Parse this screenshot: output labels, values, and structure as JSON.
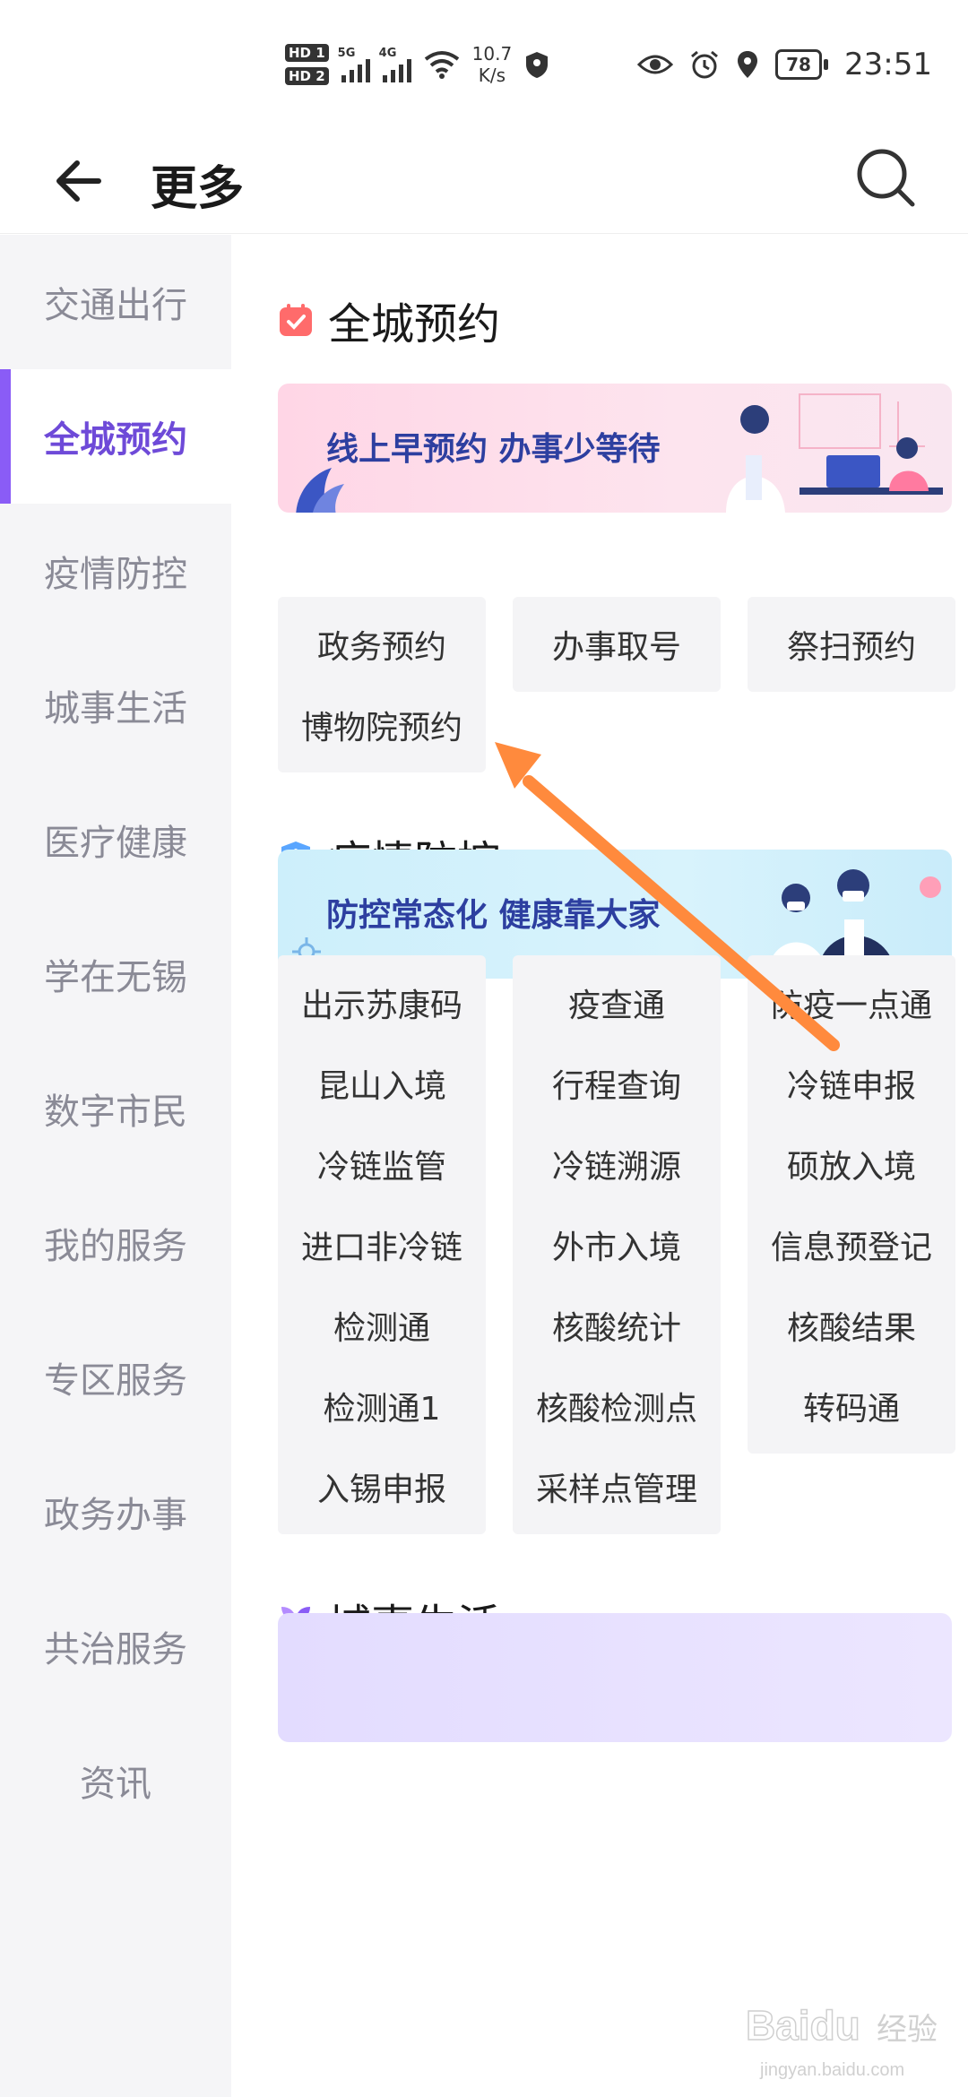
{
  "status_bar": {
    "sim1": "HD 1",
    "sim2": "HD 2",
    "net1": "5G",
    "net2": "4G",
    "speed_value": "10.7",
    "speed_unit": "K/s",
    "battery": "78",
    "time": "23:51"
  },
  "header": {
    "title": "更多"
  },
  "sidebar": {
    "items": [
      {
        "label": "交通出行"
      },
      {
        "label": "全城预约"
      },
      {
        "label": "疫情防控"
      },
      {
        "label": "城事生活"
      },
      {
        "label": "医疗健康"
      },
      {
        "label": "学在无锡"
      },
      {
        "label": "数字市民"
      },
      {
        "label": "我的服务"
      },
      {
        "label": "专区服务"
      },
      {
        "label": "政务办事"
      },
      {
        "label": "共治服务"
      },
      {
        "label": "资讯"
      }
    ],
    "active_index": 1
  },
  "sections": [
    {
      "title": "全城预约",
      "banner_text": "线上早预约 办事少等待",
      "items": [
        "政务预约",
        "办事取号",
        "祭扫预约",
        "博物院预约"
      ]
    },
    {
      "title": "疫情防控",
      "banner_text": "防控常态化 健康靠大家",
      "items": [
        "出示苏康码",
        "疫查通",
        "防疫一点通",
        "昆山入境",
        "行程查询",
        "冷链申报",
        "冷链监管",
        "冷链溯源",
        "硕放入境",
        "进口非冷链",
        "外市入境",
        "信息预登记",
        "检测通",
        "核酸统计",
        "核酸结果",
        "检测通1",
        "核酸检测点",
        "转码通",
        "入锡申报",
        "采样点管理"
      ]
    },
    {
      "title": "城事生活"
    }
  ],
  "watermark": {
    "brand": "Baidu",
    "sub": "经验",
    "url": "jingyan.baidu.com"
  },
  "colors": {
    "accent": "#8a5cf6",
    "active_text": "#6e4ad8",
    "arrow": "#ff8a3d"
  }
}
